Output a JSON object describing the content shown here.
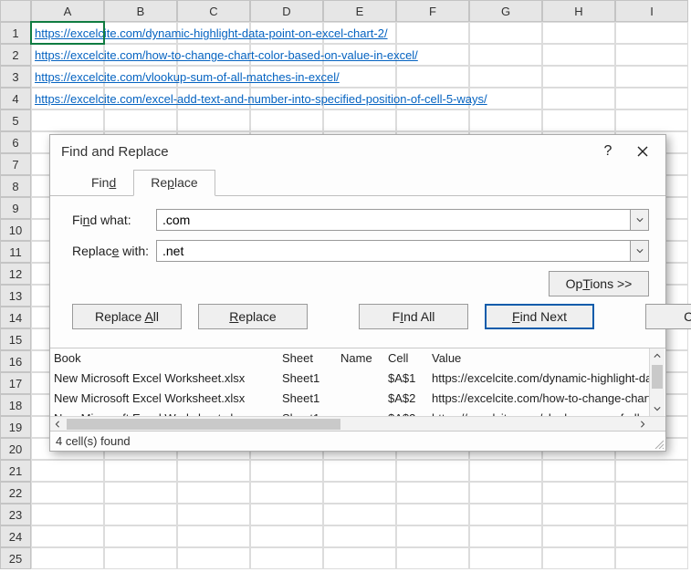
{
  "columns": [
    "A",
    "B",
    "C",
    "D",
    "E",
    "F",
    "G",
    "H",
    "I"
  ],
  "row_numbers": [
    "1",
    "2",
    "3",
    "4",
    "5",
    "6",
    "7",
    "8",
    "9",
    "10",
    "11",
    "12",
    "13",
    "14",
    "15",
    "16",
    "17",
    "18",
    "19",
    "20",
    "21",
    "22",
    "23",
    "24",
    "25"
  ],
  "links": {
    "r1": "https://excelcite.com/dynamic-highlight-data-point-on-excel-chart-2/",
    "r2": "https://excelcite.com/how-to-change-chart-color-based-on-value-in-excel/",
    "r3": "https://excelcite.com/vlookup-sum-of-all-matches-in-excel/",
    "r4": "https://excelcite.com/excel-add-text-and-number-into-specified-position-of-cell-5-ways/"
  },
  "dialog": {
    "title": "Find and Replace",
    "help": "?",
    "tabs": {
      "find": "Find",
      "find_u": "d",
      "replace": "Replace",
      "replace_u": "p"
    },
    "labels": {
      "find_what": "Find what:",
      "find_u": "n",
      "replace_with": "Replace with:",
      "replace_u": "e"
    },
    "inputs": {
      "find": ".com",
      "replace": ".net"
    },
    "options_btn": "Options >>",
    "options_u": "T",
    "buttons": {
      "replace_all": "Replace All",
      "replace_all_u": "A",
      "replace": "Replace",
      "replace_u": "R",
      "find_all": "Find All",
      "find_all_u": "I",
      "find_next": "Find Next",
      "find_next_u": "F",
      "close": "Close"
    },
    "results": {
      "headers": {
        "book": "Book",
        "sheet": "Sheet",
        "name": "Name",
        "cell": "Cell",
        "value": "Value"
      },
      "rows": [
        {
          "book": "New Microsoft Excel Worksheet.xlsx",
          "sheet": "Sheet1",
          "name": "",
          "cell": "$A$1",
          "value": "https://excelcite.com/dynamic-highlight-da"
        },
        {
          "book": "New Microsoft Excel Worksheet.xlsx",
          "sheet": "Sheet1",
          "name": "",
          "cell": "$A$2",
          "value": "https://excelcite.com/how-to-change-chart"
        }
      ],
      "partial_row": {
        "book": "New Microsoft Excel Worksheet.xlsx",
        "sheet": "Sheet1",
        "name": "",
        "cell": "$A$3",
        "value": "https://excelcite.com/vlookup-sum-of-all-m"
      }
    },
    "status": "4 cell(s) found"
  }
}
